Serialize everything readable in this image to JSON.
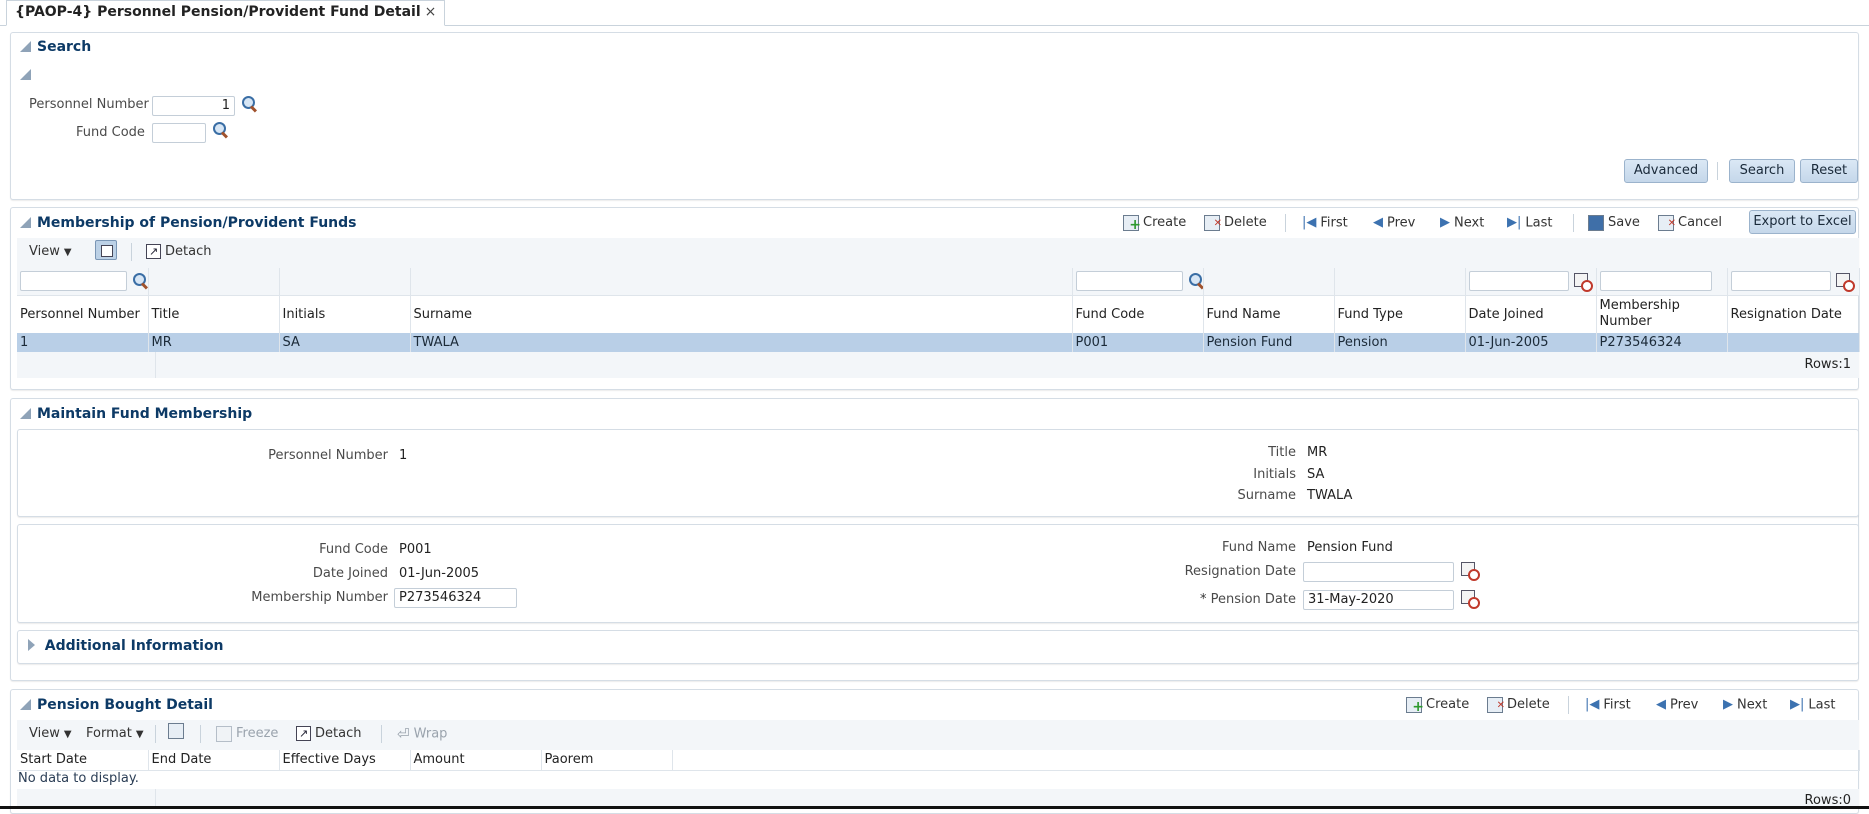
{
  "tab": {
    "title": "{PAOP-4} Personnel Pension/Provident Fund Detail",
    "close": "×"
  },
  "search": {
    "title": "Search",
    "personnel_number_label": "Personnel Number",
    "personnel_number_value": "1",
    "fund_code_label": "Fund Code",
    "fund_code_value": "",
    "advanced": "Advanced",
    "search": "Search",
    "reset": "Reset"
  },
  "membership": {
    "title": "Membership of Pension/Provident Funds",
    "toolbar": {
      "create": "Create",
      "delete": "Delete",
      "first": "First",
      "prev": "Prev",
      "next": "Next",
      "last": "Last",
      "save": "Save",
      "cancel": "Cancel",
      "export": "Export to Excel"
    },
    "view": "View",
    "detach": "Detach",
    "columns": [
      "Personnel Number",
      "Title",
      "Initials",
      "Surname",
      "Fund Code",
      "Fund Name",
      "Fund Type",
      "Date Joined",
      "Membership Number",
      "Resignation Date"
    ],
    "membership_col_line1": "Membership",
    "membership_col_line2": "Number",
    "rows": [
      [
        "1",
        "MR",
        "SA",
        "TWALA",
        "P001",
        "Pension Fund",
        "Pension",
        "01-Jun-2005",
        "P273546324",
        ""
      ]
    ],
    "rows_count": "Rows:1"
  },
  "maintain": {
    "title": "Maintain Fund Membership",
    "personnel_number_label": "Personnel Number",
    "personnel_number_value": "1",
    "title_label": "Title",
    "title_value": "MR",
    "initials_label": "Initials",
    "initials_value": "SA",
    "surname_label": "Surname",
    "surname_value": "TWALA",
    "fund_code_label": "Fund Code",
    "fund_code_value": "P001",
    "date_joined_label": "Date Joined",
    "date_joined_value": "01-Jun-2005",
    "membership_number_label": "Membership Number",
    "membership_number_value": "P273546324",
    "fund_name_label": "Fund Name",
    "fund_name_value": "Pension Fund",
    "resignation_date_label": "Resignation Date",
    "resignation_date_value": "",
    "pension_date_required": "*",
    "pension_date_label": "Pension Date",
    "pension_date_value": "31-May-2020",
    "additional_info": "Additional Information"
  },
  "bought": {
    "title": "Pension Bought Detail",
    "toolbar": {
      "create": "Create",
      "delete": "Delete",
      "first": "First",
      "prev": "Prev",
      "next": "Next",
      "last": "Last"
    },
    "view": "View",
    "format": "Format",
    "freeze": "Freeze",
    "detach": "Detach",
    "wrap": "Wrap",
    "columns": [
      "Start Date",
      "End Date",
      "Effective Days",
      "Amount",
      "Paorem"
    ],
    "empty": "No data to display.",
    "rows_count": "Rows:0"
  }
}
